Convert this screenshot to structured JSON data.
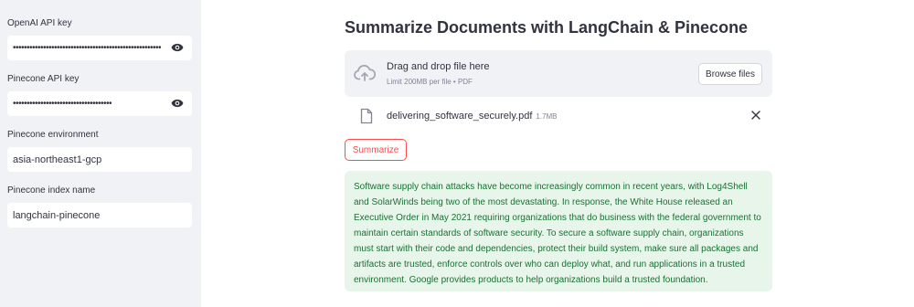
{
  "sidebar": {
    "openai_key": {
      "label": "OpenAI API key",
      "value": "••••••••••••••••••••••••••••••••••••••••••••••••••••••"
    },
    "pinecone_key": {
      "label": "Pinecone API key",
      "value": "••••••••••••••••••••••••••••••••••••"
    },
    "pinecone_env": {
      "label": "Pinecone environment",
      "value": "asia-northeast1-gcp"
    },
    "pinecone_index": {
      "label": "Pinecone index name",
      "value": "langchain-pinecone"
    }
  },
  "main": {
    "title": "Summarize Documents with LangChain & Pinecone",
    "uploader": {
      "title": "Drag and drop file here",
      "subtitle": "Limit 200MB per file • PDF",
      "browse_label": "Browse files"
    },
    "file": {
      "name": "delivering_software_securely.pdf",
      "size": "1.7MB"
    },
    "summarize_label": "Summarize",
    "summary": "Software supply chain attacks have become increasingly common in recent years, with Log4Shell and SolarWinds being two of the most devastating. In response, the White House released an Executive Order in May 2021 requiring organizations that do business with the federal government to maintain certain standards of software security. To secure a software supply chain, organizations must start with their code and dependencies, protect their build system, make sure all packages and artifacts are trusted, enforce controls over who can deploy what, and run applications in a trusted environment. Google provides products to help organizations build a trusted foundation."
  },
  "colors": {
    "accent": "#ff4b4b",
    "success_bg": "#e8f5ea",
    "success_text": "#177233",
    "sidebar_bg": "#f0f2f6"
  },
  "icons": [
    "eye-icon",
    "upload-cloud-icon",
    "file-icon",
    "close-icon"
  ]
}
